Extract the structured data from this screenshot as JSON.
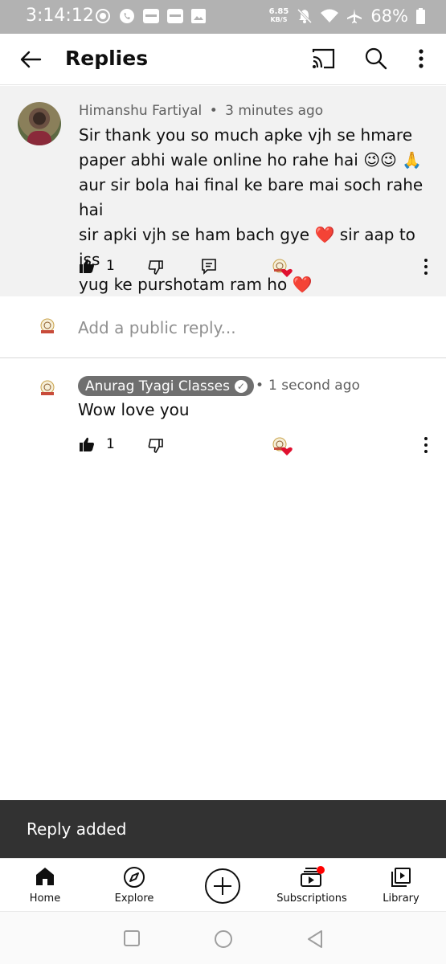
{
  "status_bar": {
    "time": "3:14:12",
    "net_speed_value": "6.85",
    "net_speed_unit": "KB/S",
    "battery": "68%"
  },
  "app_bar": {
    "title": "Replies",
    "icons": [
      "back-arrow-icon",
      "cast-icon",
      "search-icon",
      "more-vert-icon"
    ]
  },
  "parent_comment": {
    "author": "Himanshu Fartiyal",
    "separator": "•",
    "time": "3 minutes ago",
    "lines": [
      "Sir thank you so much apke vjh se hmare",
      "paper abhi wale online ho rahe hai 😉😉 🙏",
      "aur sir bola hai final ke bare mai soch rahe hai",
      "sir apki vjh se ham bach gye ❤️ sir aap to iss",
      "yug ke purshotam ram ho ❤️"
    ],
    "likes": "1"
  },
  "add_reply": {
    "placeholder": "Add a public reply..."
  },
  "reply_comment": {
    "author": "Anurag Tyagi Classes",
    "verified_mark": "✓",
    "separator": "•",
    "time": "1 second ago",
    "text": "Wow love you",
    "likes": "1"
  },
  "snackbar": {
    "message": "Reply added"
  },
  "bottom_nav": {
    "items": [
      {
        "label": "Home",
        "icon": "home-icon"
      },
      {
        "label": "Explore",
        "icon": "explore-icon"
      },
      {
        "label": "",
        "icon": "create-icon"
      },
      {
        "label": "Subscriptions",
        "icon": "subscriptions-icon"
      },
      {
        "label": "Library",
        "icon": "library-icon"
      }
    ]
  },
  "colors": {
    "status_bar_bg": "#b2b2b2",
    "parent_bg": "#f2f2f2",
    "chip_bg": "#6f6f6f",
    "snackbar_bg": "#323232",
    "heart": "#e0102f",
    "notification_dot": "#ff0000"
  }
}
